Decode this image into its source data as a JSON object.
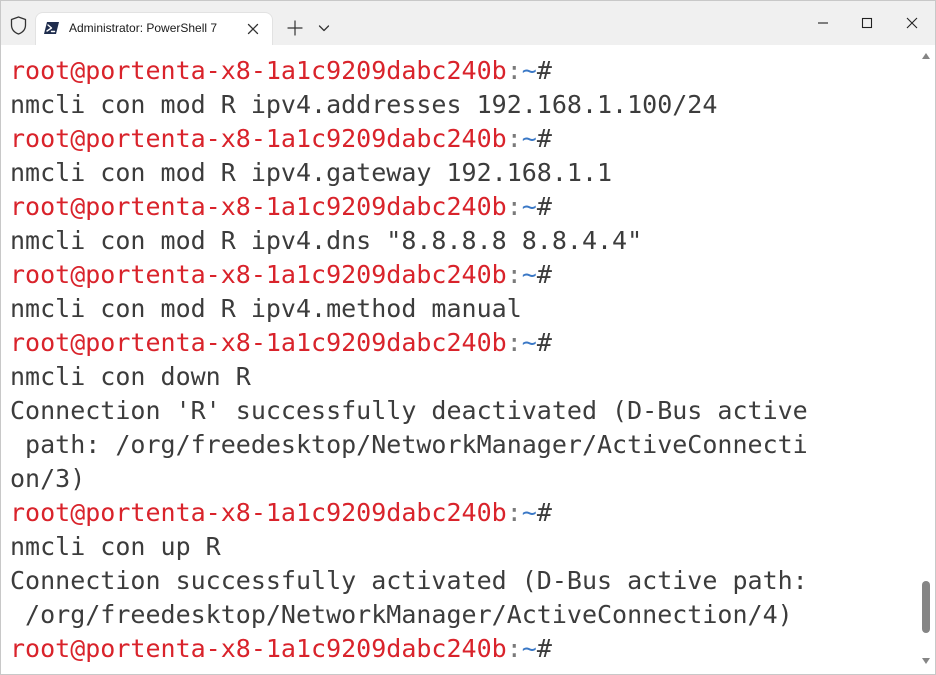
{
  "window": {
    "tab_title": "Administrator: PowerShell 7"
  },
  "icons": {
    "shield": "shield-icon",
    "tab": "powershell-icon",
    "tab_close": "close-icon",
    "new_tab": "plus-icon",
    "dropdown": "chevron-down-icon",
    "minimize": "minimize-icon",
    "maximize": "maximize-icon",
    "close": "close-icon"
  },
  "colors": {
    "prompt_user": "#d9232b",
    "prompt_path": "#3a78c6",
    "text": "#3c3c3c",
    "titlebar_bg": "#f0f0f0"
  },
  "terminal": {
    "prompt": {
      "user_host": "root@portenta-x8-1a1c9209dabc240b",
      "separator": ":",
      "path": "~",
      "symbol": "#"
    },
    "lines": [
      {
        "type": "prompt"
      },
      {
        "type": "text",
        "text": "nmcli con mod R ipv4.addresses 192.168.1.100/24"
      },
      {
        "type": "prompt"
      },
      {
        "type": "text",
        "text": "nmcli con mod R ipv4.gateway 192.168.1.1"
      },
      {
        "type": "prompt"
      },
      {
        "type": "text",
        "text": "nmcli con mod R ipv4.dns \"8.8.8.8 8.8.4.4\""
      },
      {
        "type": "prompt"
      },
      {
        "type": "text",
        "text": "nmcli con mod R ipv4.method manual"
      },
      {
        "type": "prompt"
      },
      {
        "type": "text",
        "text": "nmcli con down R"
      },
      {
        "type": "text",
        "text": "Connection 'R' successfully deactivated (D-Bus active"
      },
      {
        "type": "text",
        "text": " path: /org/freedesktop/NetworkManager/ActiveConnecti"
      },
      {
        "type": "text",
        "text": "on/3)"
      },
      {
        "type": "prompt"
      },
      {
        "type": "text",
        "text": "nmcli con up R"
      },
      {
        "type": "text",
        "text": "Connection successfully activated (D-Bus active path:"
      },
      {
        "type": "text",
        "text": " /org/freedesktop/NetworkManager/ActiveConnection/4)"
      },
      {
        "type": "prompt"
      }
    ]
  }
}
